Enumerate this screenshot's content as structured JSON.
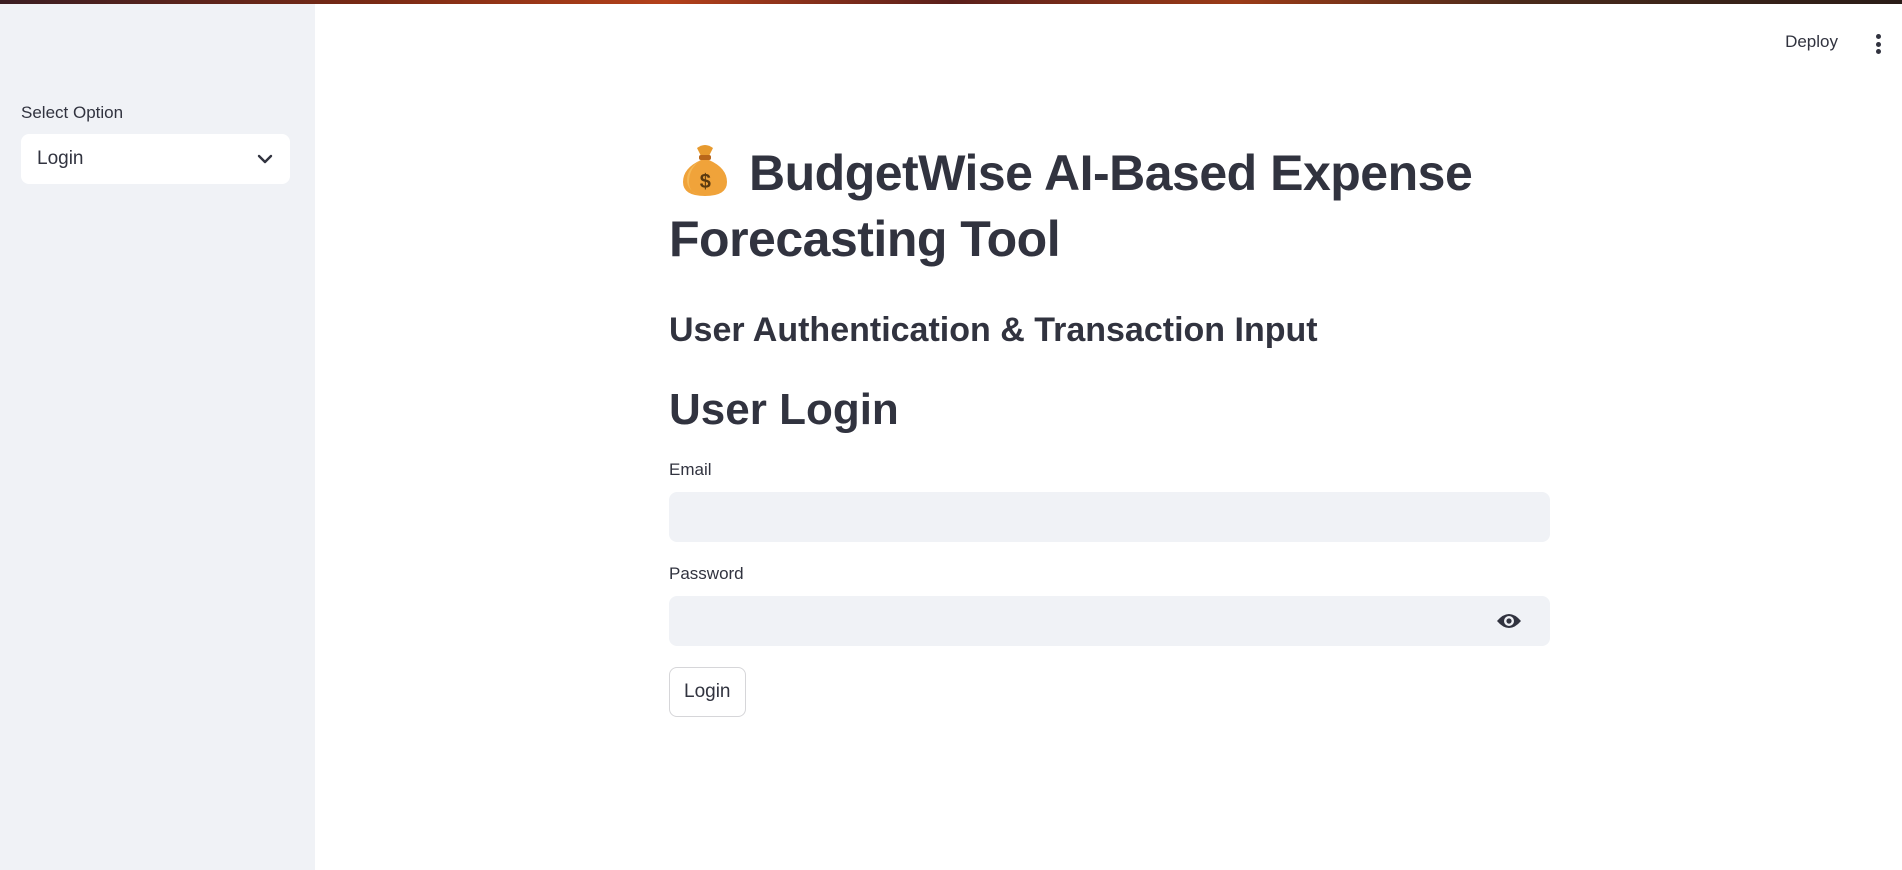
{
  "sidebar": {
    "select_label": "Select Option",
    "selected_value": "Login"
  },
  "header": {
    "deploy_label": "Deploy"
  },
  "main": {
    "title_emoji": "💰",
    "title": "BudgetWise AI-Based Expense Forecasting Tool",
    "subtitle": "User Authentication & Transaction Input",
    "section_title": "User Login",
    "email_label": "Email",
    "email_value": "",
    "password_label": "Password",
    "password_value": "",
    "login_button": "Login"
  },
  "colors": {
    "sidebar_bg": "#f0f2f6",
    "text": "#31333f",
    "input_bg": "#f0f2f6"
  }
}
